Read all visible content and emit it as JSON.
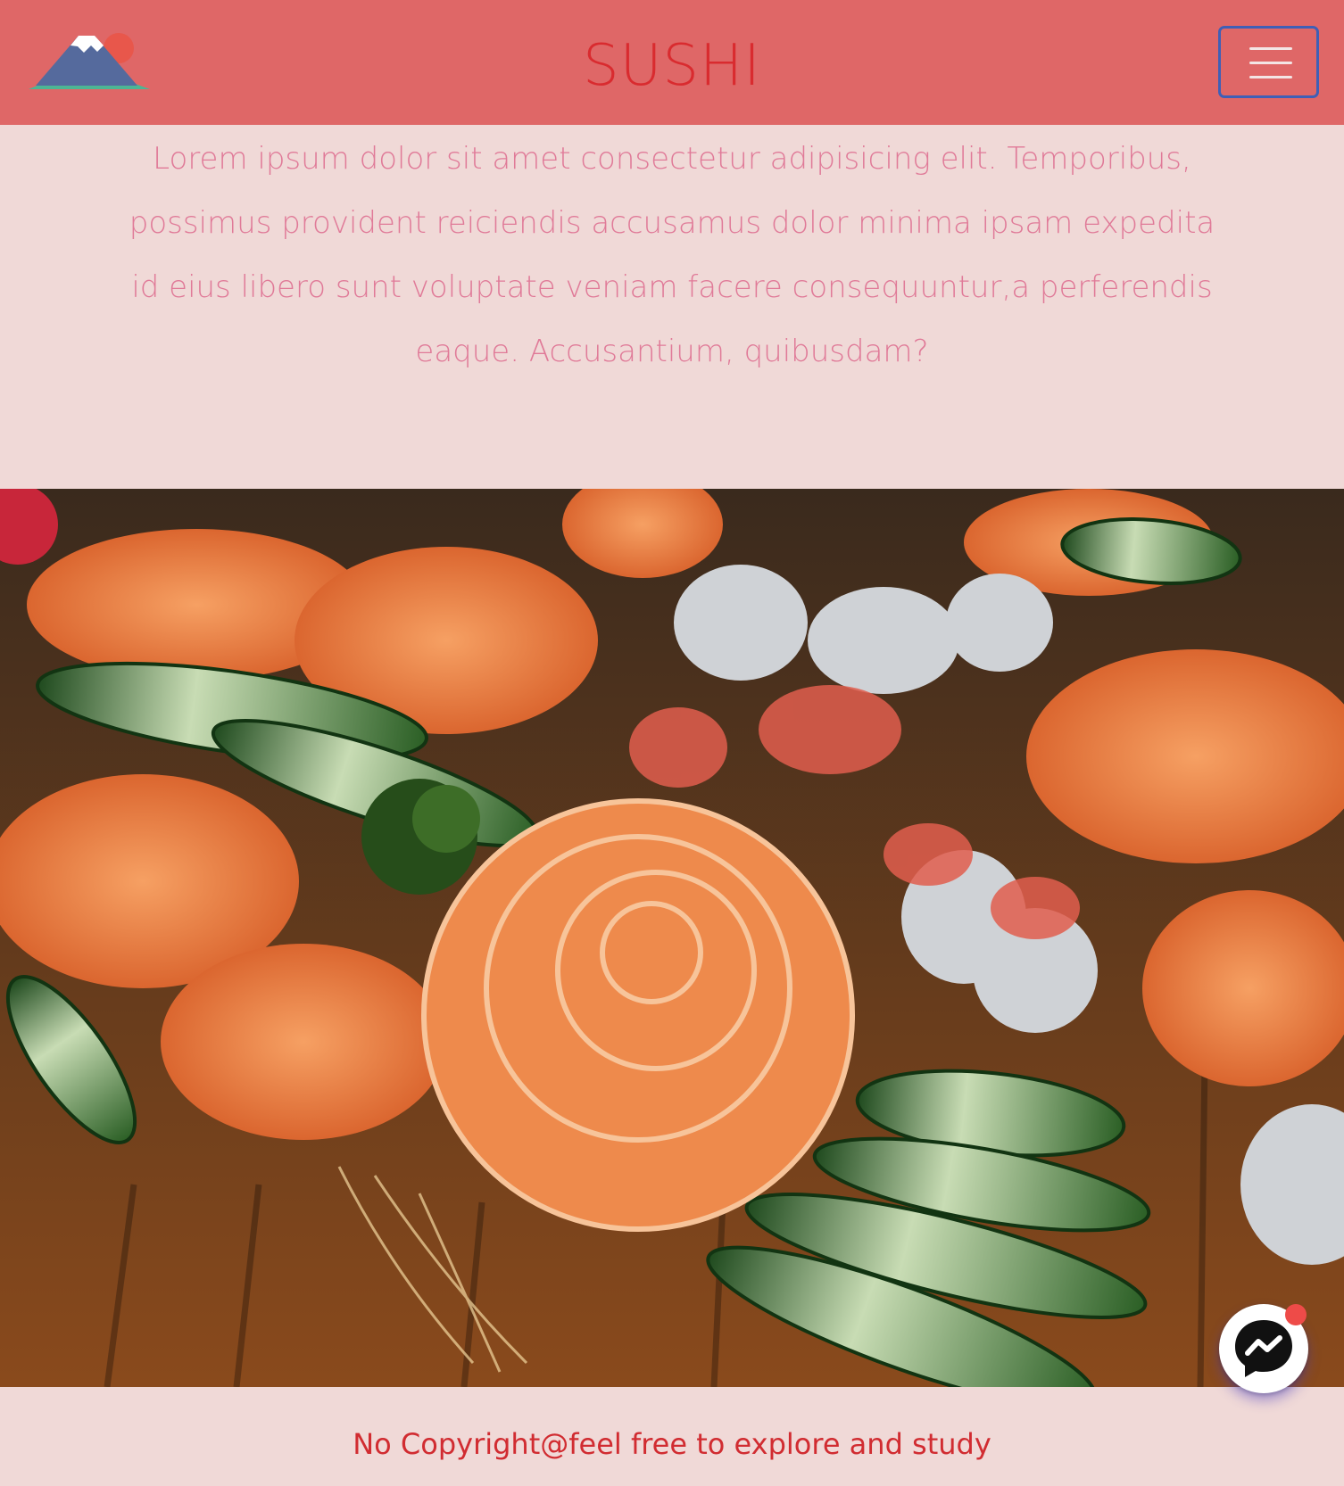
{
  "header": {
    "title": "SUSHI",
    "logo_icon": "mount-fuji-icon",
    "menu_icon": "hamburger-menu-icon"
  },
  "intro": {
    "text": "Lorem ipsum dolor sit amet consectetur adipisicing elit. Temporibus, possimus provident reiciendis accusamus dolor minima ipsam expedita id eius libero sunt voluptate veniam facere consequuntur,a perferendis eaque. Accusantium, quibusdam?"
  },
  "footer": {
    "text": "No Copyright@feel free to explore and study"
  },
  "chat": {
    "icon": "messenger-icon",
    "has_notification": true
  },
  "colors": {
    "header_bg": "#df6767",
    "page_bg": "#f0d9d7",
    "title": "#d92b2f",
    "intro_text": "#e07a98",
    "footer_text": "#d12c31",
    "menu_border": "#3f5fb6"
  }
}
